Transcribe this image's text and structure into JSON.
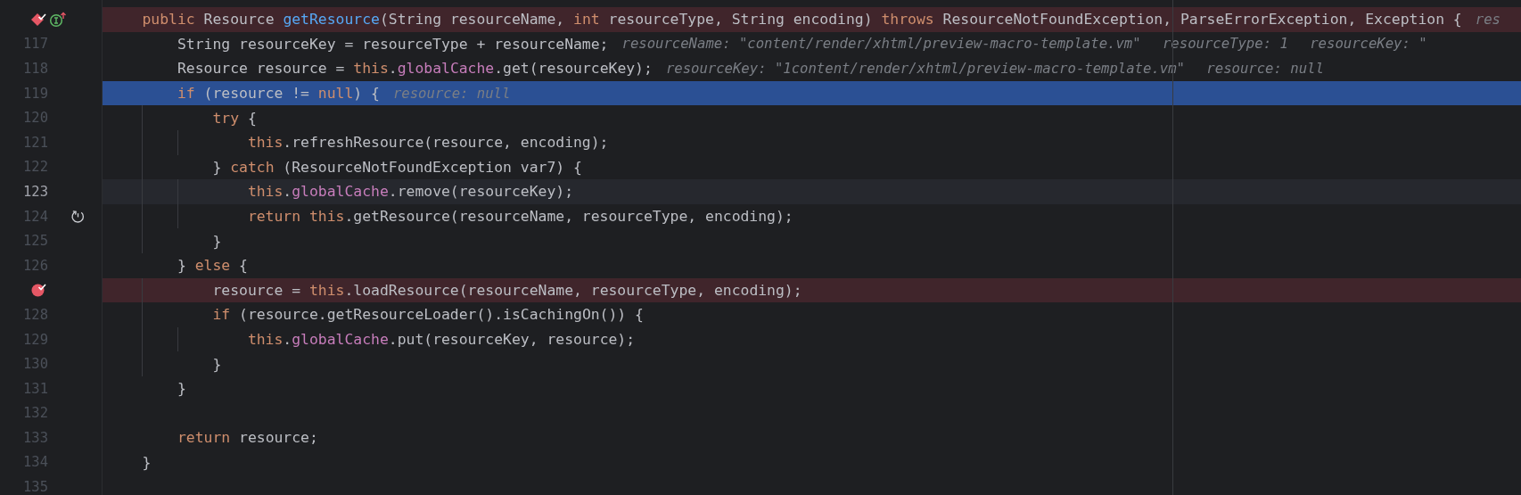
{
  "editor": {
    "lines": [
      {
        "method_breakpoint": true,
        "overrides_marker": true,
        "code": [
          {
            "kind": "keyword",
            "text": "    public"
          },
          {
            "kind": "plain",
            "text": " Resource "
          },
          {
            "kind": "method",
            "text": "getResource"
          },
          {
            "kind": "plain",
            "text": "(String resourceName, "
          },
          {
            "kind": "keyword",
            "text": "int"
          },
          {
            "kind": "plain",
            "text": " resourceType, String encoding) "
          },
          {
            "kind": "keyword",
            "text": "throws"
          },
          {
            "kind": "plain",
            "text": " ResourceNotFoundException, ParseErrorException, Exception {"
          }
        ],
        "hints": [
          "res"
        ]
      },
      {
        "number": "117",
        "code": [
          {
            "kind": "plain",
            "text": "        String resourceKey = resourceType + resourceName;"
          }
        ],
        "hints": [
          "resourceName: \"content/render/xhtml/preview-macro-template.vm\"",
          "resourceType: 1",
          "resourceKey: \""
        ]
      },
      {
        "number": "118",
        "code": [
          {
            "kind": "plain",
            "text": "        Resource resource = "
          },
          {
            "kind": "keyword",
            "text": "this"
          },
          {
            "kind": "plain",
            "text": "."
          },
          {
            "kind": "field",
            "text": "globalCache"
          },
          {
            "kind": "plain",
            "text": ".get(resourceKey);"
          }
        ],
        "hints": [
          "resourceKey: \"1content/render/xhtml/preview-macro-template.vm\"",
          "resource: null"
        ]
      },
      {
        "number": "119",
        "execution_point": true,
        "code": [
          {
            "kind": "keyword",
            "text": "        if"
          },
          {
            "kind": "plain",
            "text": " (resource != "
          },
          {
            "kind": "keyword",
            "text": "null"
          },
          {
            "kind": "plain",
            "text": ") {"
          }
        ],
        "hints": [
          "resource: null"
        ]
      },
      {
        "number": "120",
        "code": [
          {
            "kind": "keyword",
            "text": "            try"
          },
          {
            "kind": "plain",
            "text": " {"
          }
        ]
      },
      {
        "number": "121",
        "code": [
          {
            "kind": "keyword",
            "text": "                this"
          },
          {
            "kind": "plain",
            "text": ".refreshResource(resource, encoding);"
          }
        ]
      },
      {
        "number": "122",
        "code": [
          {
            "kind": "plain",
            "text": "            } "
          },
          {
            "kind": "keyword",
            "text": "catch"
          },
          {
            "kind": "plain",
            "text": " (ResourceNotFoundException var7) {"
          }
        ]
      },
      {
        "number": "123",
        "current": true,
        "code": [
          {
            "kind": "keyword",
            "text": "                this"
          },
          {
            "kind": "plain",
            "text": "."
          },
          {
            "kind": "field",
            "text": "globalCache"
          },
          {
            "kind": "plain",
            "text": ".remove(resourceKey);"
          }
        ]
      },
      {
        "number": "124",
        "drop_frame": true,
        "code": [
          {
            "kind": "keyword",
            "text": "                return"
          },
          {
            "kind": "keyword",
            "text": " this"
          },
          {
            "kind": "plain",
            "text": ".getResource(resourceName, resourceType, encoding);"
          }
        ]
      },
      {
        "number": "125",
        "code": [
          {
            "kind": "plain",
            "text": "            }"
          }
        ]
      },
      {
        "number": "126",
        "code": [
          {
            "kind": "plain",
            "text": "        } "
          },
          {
            "kind": "keyword",
            "text": "else"
          },
          {
            "kind": "plain",
            "text": " {"
          }
        ]
      },
      {
        "breakpoint": true,
        "code": [
          {
            "kind": "plain",
            "text": "            resource = "
          },
          {
            "kind": "keyword",
            "text": "this"
          },
          {
            "kind": "plain",
            "text": ".loadResource(resourceName, resourceType, encoding);"
          }
        ]
      },
      {
        "number": "128",
        "code": [
          {
            "kind": "keyword",
            "text": "            if"
          },
          {
            "kind": "plain",
            "text": " (resource.getResourceLoader().isCachingOn()) {"
          }
        ]
      },
      {
        "number": "129",
        "code": [
          {
            "kind": "keyword",
            "text": "                this"
          },
          {
            "kind": "plain",
            "text": "."
          },
          {
            "kind": "field",
            "text": "globalCache"
          },
          {
            "kind": "plain",
            "text": ".put(resourceKey, resource);"
          }
        ]
      },
      {
        "number": "130",
        "code": [
          {
            "kind": "plain",
            "text": "            }"
          }
        ]
      },
      {
        "number": "131",
        "code": [
          {
            "kind": "plain",
            "text": "        }"
          }
        ]
      },
      {
        "number": "132"
      },
      {
        "number": "133",
        "code": [
          {
            "kind": "keyword",
            "text": "        return"
          },
          {
            "kind": "plain",
            "text": " resource;"
          }
        ]
      },
      {
        "number": "134",
        "code": [
          {
            "kind": "plain",
            "text": "    }"
          }
        ]
      },
      {
        "number": "135"
      }
    ]
  }
}
